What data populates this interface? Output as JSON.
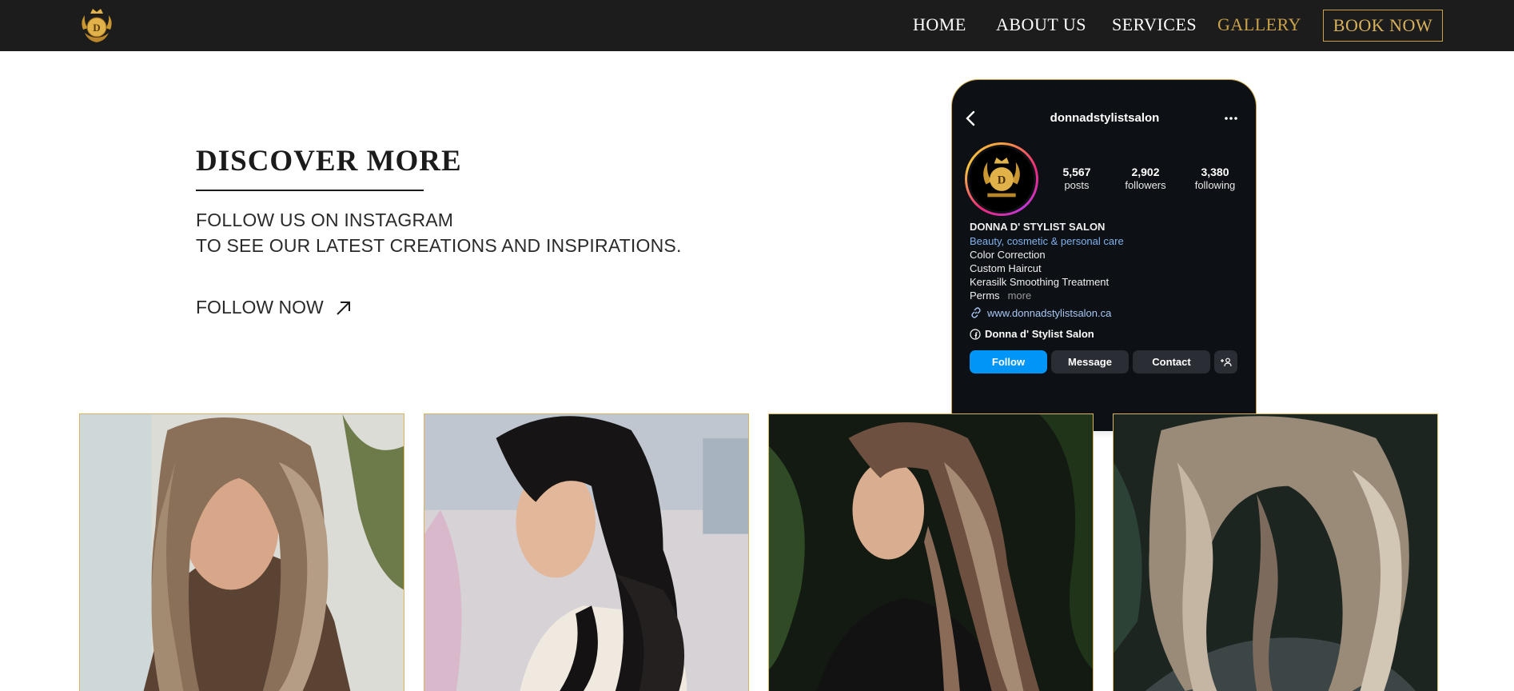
{
  "nav": {
    "logo_icon": "salon-crown-logo",
    "links": [
      {
        "label": "HOME",
        "active": false
      },
      {
        "label": "ABOUT US",
        "active": false
      },
      {
        "label": "SERVICES",
        "active": false
      },
      {
        "label": "GALLERY",
        "active": true
      }
    ],
    "book_label": "BOOK NOW",
    "accent_color": "#c9a24a",
    "bar_color": "#1c1c1c"
  },
  "discover": {
    "heading": "DISCOVER MORE",
    "line1": "FOLLOW US ON INSTAGRAM",
    "line2": "TO SEE OUR LATEST CREATIONS AND INSPIRATIONS.",
    "follow_label": "FOLLOW NOW",
    "follow_icon": "arrow-up-right-icon"
  },
  "instagram": {
    "username": "donnadstylistsalon",
    "stats": [
      {
        "value": "5,567",
        "label": "posts"
      },
      {
        "value": "2,902",
        "label": "followers"
      },
      {
        "value": "3,380",
        "label": "following"
      }
    ],
    "name": "DONNA D' STYLIST SALON",
    "category": "Beauty, cosmetic & personal care",
    "bio": [
      "Color Correction",
      "Custom Haircut",
      "Kerasilk Smoothing Treatment",
      "Perms"
    ],
    "more_label": "more",
    "website": "www.donnadstylistsalon.ca",
    "facebook": "Donna d' Stylist Salon",
    "buttons": {
      "follow": "Follow",
      "message": "Message",
      "contact": "Contact",
      "add": "+°"
    },
    "follow_color": "#0095f6"
  },
  "gallery": {
    "tiles": [
      {
        "name": "gallery-photo-1",
        "subject": "light-brown-balayage-waves"
      },
      {
        "name": "gallery-photo-2",
        "subject": "black-layered-waves"
      },
      {
        "name": "gallery-photo-3",
        "subject": "brown-crimped-waves"
      },
      {
        "name": "gallery-photo-4",
        "subject": "ash-blonde-bob-waves"
      }
    ]
  }
}
